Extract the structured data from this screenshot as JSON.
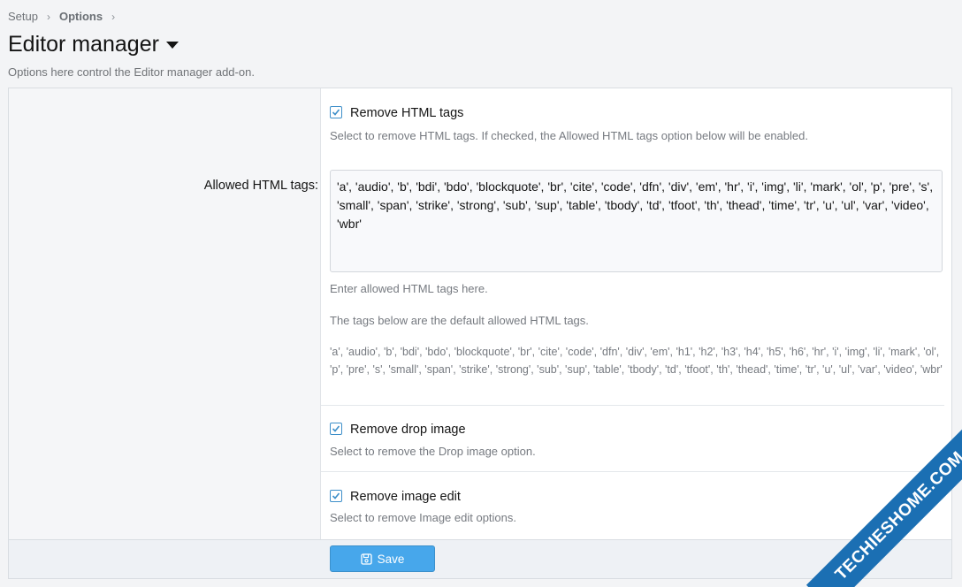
{
  "breadcrumb": {
    "items": [
      "Setup",
      "Options"
    ]
  },
  "page": {
    "title": "Editor manager",
    "description": "Options here control the Editor manager add-on."
  },
  "options": {
    "remove_html": {
      "label": "Remove HTML tags",
      "checked": true,
      "hint": "Select to remove HTML tags. If checked, the Allowed HTML tags option below will be enabled."
    },
    "allowed": {
      "label": "Allowed HTML tags:",
      "value": "'a', 'audio', 'b', 'bdi', 'bdo', 'blockquote', 'br', 'cite', 'code', 'dfn', 'div', 'em', 'hr', 'i', 'img', 'li', 'mark', 'ol', 'p', 'pre', 's', 'small', 'span', 'strike', 'strong', 'sub', 'sup', 'table', 'tbody', 'td', 'tfoot', 'th', 'thead', 'time', 'tr', 'u', 'ul', 'var', 'video', 'wbr'",
      "hint": "Enter allowed HTML tags here.",
      "defaults_intro": "The tags below are the default allowed HTML tags.",
      "defaults": "'a', 'audio', 'b', 'bdi', 'bdo', 'blockquote', 'br', 'cite', 'code', 'dfn', 'div', 'em', 'h1', 'h2', 'h3', 'h4', 'h5', 'h6', 'hr', 'i', 'img', 'li', 'mark', 'ol', 'p', 'pre', 's', 'small', 'span', 'strike', 'strong', 'sub', 'sup', 'table', 'tbody', 'td', 'tfoot', 'th', 'thead', 'time', 'tr', 'u', 'ul', 'var', 'video', 'wbr'"
    },
    "remove_drop_image": {
      "label": "Remove drop image",
      "checked": true,
      "hint": "Select to remove the Drop image option."
    },
    "remove_image_edit": {
      "label": "Remove image edit",
      "checked": true,
      "hint": "Select to remove Image edit options."
    }
  },
  "actions": {
    "save_label": "Save"
  },
  "watermark": {
    "text": "TECHIESHOME.COM",
    "color": "#1b6fb3"
  },
  "colors": {
    "accent": "#47a7eb",
    "checkbox": "#3d8fc9"
  }
}
